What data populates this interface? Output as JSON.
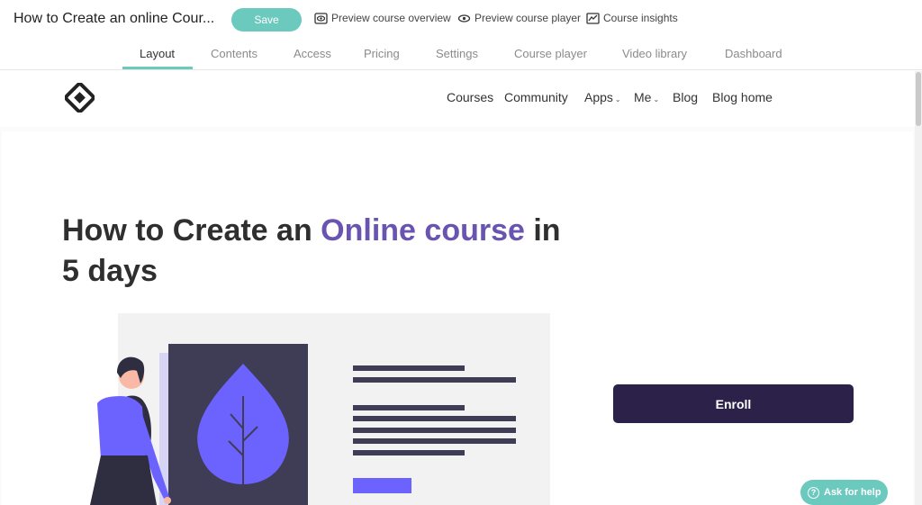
{
  "editor": {
    "course_title": "How to Create an online Cour...",
    "save_label": "Save",
    "actions": {
      "preview_overview": "Preview course overview",
      "preview_player": "Preview course player",
      "insights": "Course insights"
    },
    "tabs": [
      "Layout",
      "Contents",
      "Access",
      "Pricing",
      "Settings",
      "Course player",
      "Video library",
      "Dashboard"
    ],
    "active_tab": "Layout"
  },
  "site": {
    "nav": {
      "courses": "Courses",
      "community": "Community",
      "apps": "Apps",
      "me": "Me",
      "blog": "Blog",
      "blog_home": "Blog home"
    },
    "hero": {
      "title_part1": "How to Create an ",
      "title_accent": "Online course",
      "title_part2": " in 5 days"
    },
    "enroll_label": "Enroll",
    "help_label": "Ask for help"
  },
  "colors": {
    "accent_teal": "#6cc9be",
    "brand_purple": "#6a54b1",
    "enroll_dark": "#2b2149",
    "illustration_purple": "#6c63ff"
  }
}
